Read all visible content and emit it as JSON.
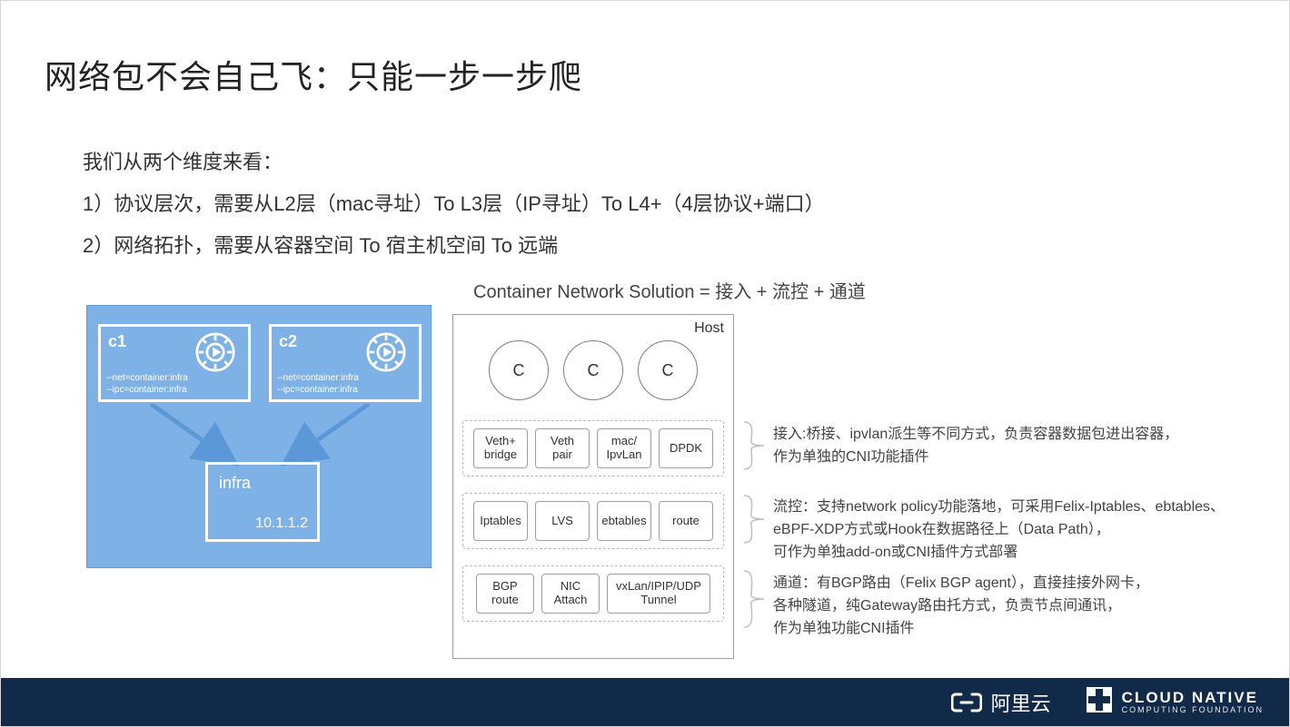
{
  "title": "网络包不会自己飞：只能一步一步爬",
  "intro": {
    "lead": "我们从两个维度来看：",
    "line1": "1）协议层次，需要从L2层（mac寻址）To  L3层（IP寻址）To L4+（4层协议+端口）",
    "line2": "2）网络拓扑，需要从容器空间 To  宿主机空间 To 远端"
  },
  "formula": "Container Network Solution = 接入 + 流控 + 通道",
  "pod": {
    "c1": {
      "label": "c1",
      "opt1": "--net=container:infra",
      "opt2": "--ipc=container:infra"
    },
    "c2": {
      "label": "c2",
      "opt1": "--net=container:infra",
      "opt2": "--ipc=container:infra"
    },
    "infra": {
      "label": "infra",
      "ip": "10.1.1.2"
    }
  },
  "host": {
    "title": "Host",
    "circles": [
      "C",
      "C",
      "C"
    ],
    "rows": {
      "access": [
        "Veth+\nbridge",
        "Veth\npair",
        "mac/\nIpvLan",
        "DPDK"
      ],
      "flow": [
        "Iptables",
        "LVS",
        "ebtables",
        "route"
      ],
      "tunnel": [
        "BGP\nroute",
        "NIC\nAttach",
        "vxLan/IPIP/UDP\nTunnel"
      ]
    }
  },
  "descriptions": {
    "access": "接入:桥接、ipvlan派生等不同方式，负责容器数据包进出容器，\n         作为单独的CNI功能插件",
    "flow": "流控：支持network policy功能落地，可采用Felix-Iptables、ebtables、\n         eBPF-XDP方式或Hook在数据路径上（Data Path），\n         可作为单独add-on或CNI插件方式部署",
    "tunnel": "通道：有BGP路由（Felix BGP agent），直接挂接外网卡，\n         各种隧道，纯Gateway路由托方式，负责节点间通讯，\n         作为单独功能CNI插件"
  },
  "footer": {
    "aliyun": "阿里云",
    "cncf_top": "CLOUD NATIVE",
    "cncf_bottom": "COMPUTING FOUNDATION"
  }
}
